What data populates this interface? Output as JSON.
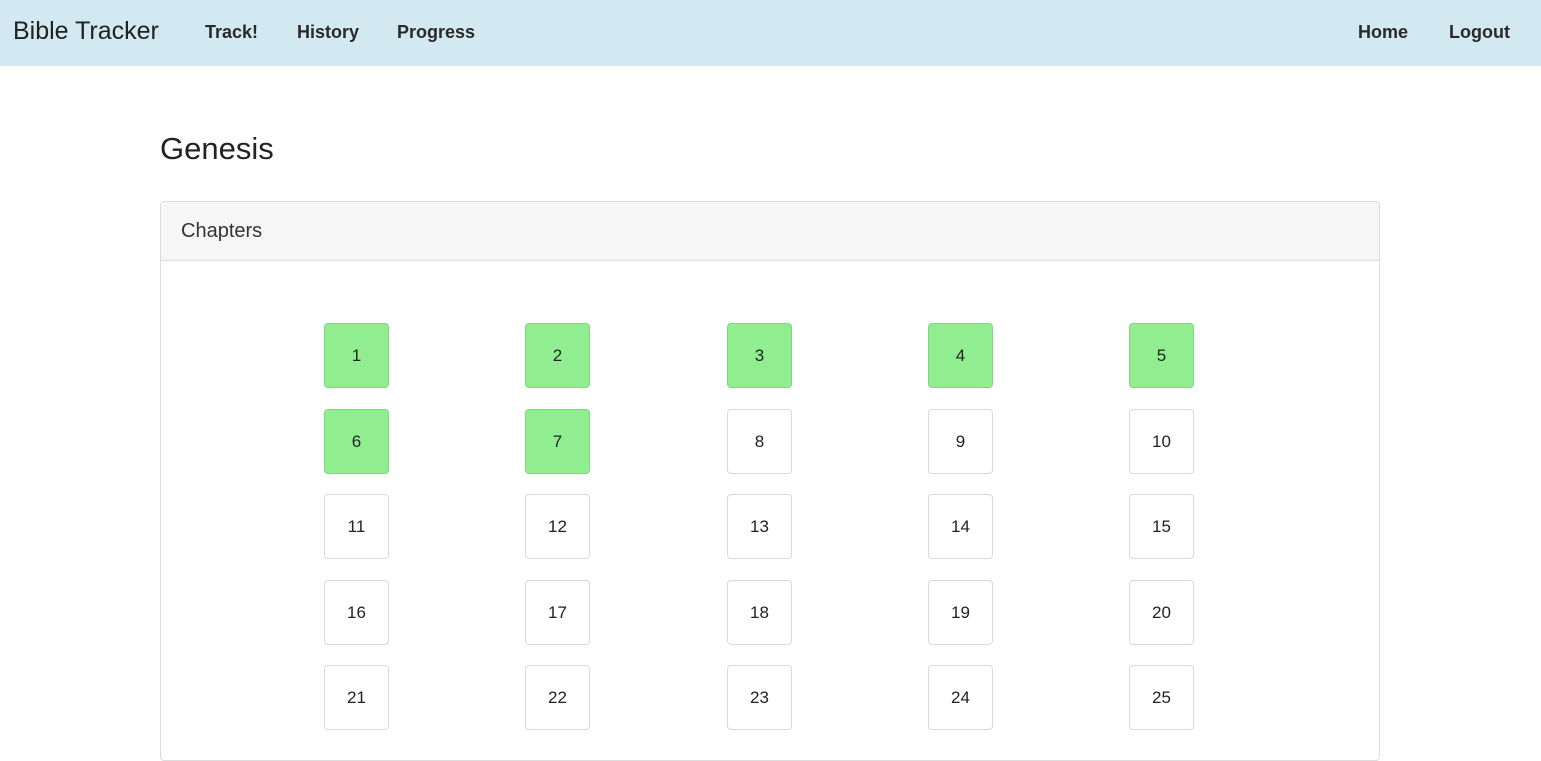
{
  "navbar": {
    "brand": "Bible Tracker",
    "left_links": [
      "Track!",
      "History",
      "Progress"
    ],
    "right_links": [
      "Home",
      "Logout"
    ]
  },
  "page": {
    "title": "Genesis"
  },
  "card": {
    "header": "Chapters"
  },
  "colors": {
    "navbar_bg": "#d3e9f1",
    "read_chapter": "#90ee90"
  },
  "chapters": [
    {
      "number": "1",
      "read": true
    },
    {
      "number": "2",
      "read": true
    },
    {
      "number": "3",
      "read": true
    },
    {
      "number": "4",
      "read": true
    },
    {
      "number": "5",
      "read": true
    },
    {
      "number": "6",
      "read": true
    },
    {
      "number": "7",
      "read": true
    },
    {
      "number": "8",
      "read": false
    },
    {
      "number": "9",
      "read": false
    },
    {
      "number": "10",
      "read": false
    },
    {
      "number": "11",
      "read": false
    },
    {
      "number": "12",
      "read": false
    },
    {
      "number": "13",
      "read": false
    },
    {
      "number": "14",
      "read": false
    },
    {
      "number": "15",
      "read": false
    },
    {
      "number": "16",
      "read": false
    },
    {
      "number": "17",
      "read": false
    },
    {
      "number": "18",
      "read": false
    },
    {
      "number": "19",
      "read": false
    },
    {
      "number": "20",
      "read": false
    },
    {
      "number": "21",
      "read": false
    },
    {
      "number": "22",
      "read": false
    },
    {
      "number": "23",
      "read": false
    },
    {
      "number": "24",
      "read": false
    },
    {
      "number": "25",
      "read": false
    }
  ]
}
